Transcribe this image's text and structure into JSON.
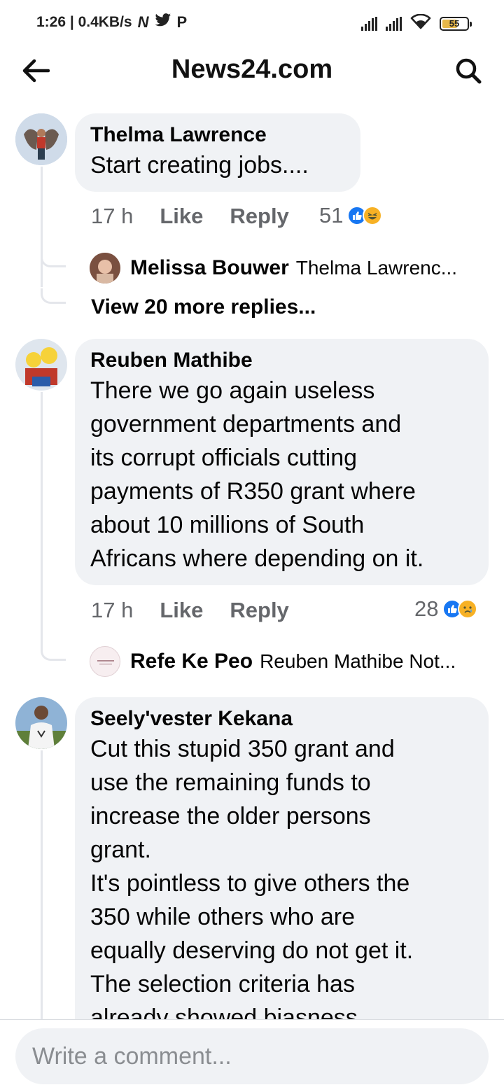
{
  "status_bar": {
    "time_speed": "1:26 | 0.4KB/s",
    "icon_n": "N",
    "icon_p": "P",
    "battery": "55"
  },
  "header": {
    "title": "News24.com"
  },
  "comments": [
    {
      "author": "Thelma Lawrence",
      "text": "Start creating jobs....",
      "time": "17 h",
      "like": "Like",
      "reply": "Reply",
      "reaction_count": "51",
      "replies": [
        {
          "author": "Melissa Bouwer",
          "snippet": "Thelma Lawrenc..."
        }
      ],
      "more_replies": "View 20 more replies..."
    },
    {
      "author": "Reuben Mathibe",
      "text": "There we go again useless\ngovernment departments and\nits corrupt officials cutting\npayments of R350 grant where\nabout 10 millions of South\nAfricans where depending on it.",
      "time": "17 h",
      "like": "Like",
      "reply": "Reply",
      "reaction_count": "28",
      "replies": [
        {
          "author": "Refe Ke Peo",
          "snippet": "Reuben Mathibe Not..."
        }
      ]
    },
    {
      "author": "Seely'vester Kekana",
      "text": "Cut this stupid 350 grant and\nuse the remaining funds to\nincrease the older persons\ngrant.\nIt's pointless to give others the\n350 while others who are\nequally deserving do not get it.\nThe selection criteria has\nalready showed biasness"
    }
  ],
  "comment_bar": {
    "placeholder": "Write a comment..."
  },
  "colors": {
    "bubble": "#f0f2f5",
    "secondary_text": "#65676b",
    "like_blue": "#1877f2",
    "emoji_yellow": "#f7b125"
  }
}
